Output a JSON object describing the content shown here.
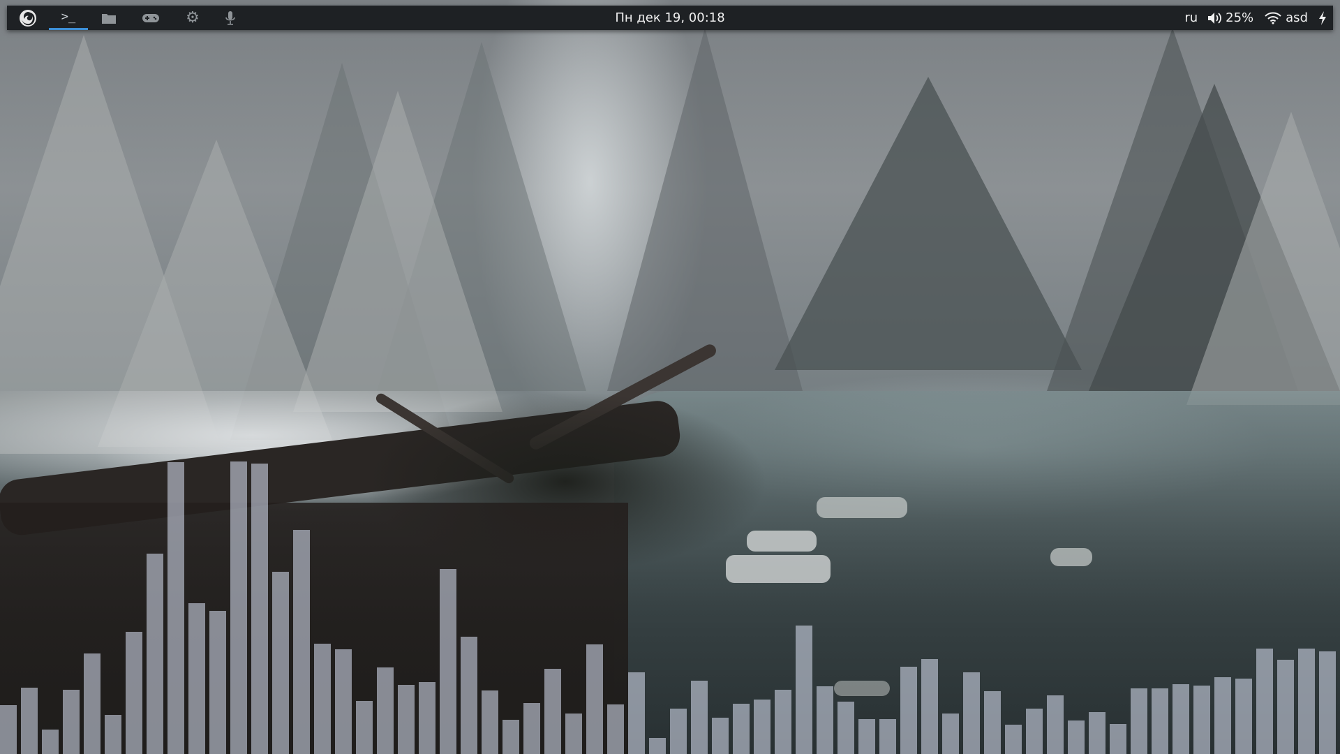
{
  "panel": {
    "launchers": [
      {
        "name": "firefox",
        "icon": "firefox-icon",
        "active": false
      },
      {
        "name": "terminal",
        "icon": "terminal-icon",
        "glyph": ">_",
        "active": true
      },
      {
        "name": "files",
        "icon": "folder-icon",
        "active": false
      },
      {
        "name": "games",
        "icon": "gamepad-icon",
        "active": false
      },
      {
        "name": "settings",
        "icon": "gear-icon",
        "active": false
      },
      {
        "name": "microphone",
        "icon": "microphone-icon",
        "active": false
      }
    ],
    "clock": "Пн дек 19, 00:18",
    "tray": {
      "keyboard_layout": "ru",
      "volume_icon": "speaker-icon",
      "volume_percent": "25%",
      "wifi_icon": "wifi-icon",
      "network_name": "asd",
      "power_icon": "lightning-icon"
    },
    "colors": {
      "background": "#1e2124",
      "active_indicator": "#3d8fd6",
      "text": "#f0f0f0"
    }
  },
  "visualizer": {
    "bar_color": "#c8cede",
    "levels": [
      0.065,
      0.088,
      0.032,
      0.085,
      0.133,
      0.052,
      0.162,
      0.266,
      0.387,
      0.2,
      0.19,
      0.388,
      0.385,
      0.242,
      0.297,
      0.146,
      0.139,
      0.07,
      0.115,
      0.092,
      0.095,
      0.245,
      0.156,
      0.084,
      0.045,
      0.068,
      0.113,
      0.054,
      0.145,
      0.066,
      0.108,
      0.021,
      0.06,
      0.097,
      0.048,
      0.067,
      0.072,
      0.085,
      0.17,
      0.09,
      0.069,
      0.046,
      0.046,
      0.116,
      0.126,
      0.054,
      0.108,
      0.083,
      0.039,
      0.06,
      0.078,
      0.044,
      0.056,
      0.04,
      0.087,
      0.087,
      0.093,
      0.091,
      0.102,
      0.1,
      0.14,
      0.125,
      0.14,
      0.136
    ]
  }
}
